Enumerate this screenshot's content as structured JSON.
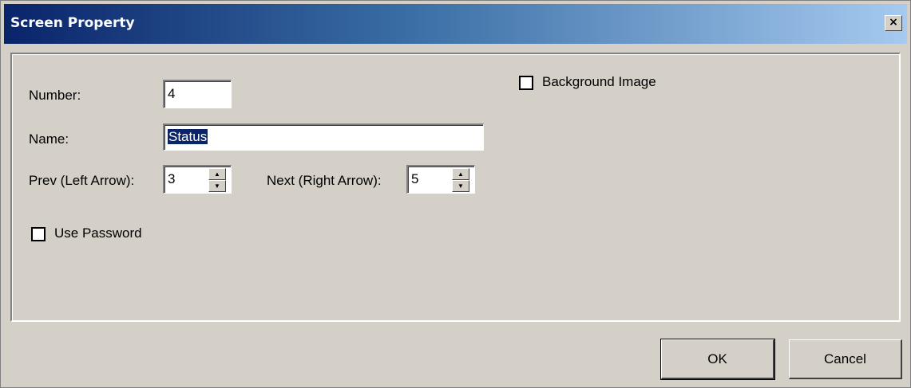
{
  "window": {
    "title": "Screen Property",
    "close_glyph": "×"
  },
  "form": {
    "number_label": "Number:",
    "number_value": "4",
    "name_label": "Name:",
    "name_value": "Status",
    "prev_label": "Prev (Left Arrow):",
    "prev_value": "3",
    "next_label": "Next (Right Arrow):",
    "next_value": "5",
    "use_password_label": "Use Password",
    "use_password_checked": false,
    "background_image_label": "Background Image",
    "background_image_checked": false
  },
  "buttons": {
    "ok": "OK",
    "cancel": "Cancel"
  },
  "icons": {
    "spin_up": "▲",
    "spin_down": "▼"
  }
}
